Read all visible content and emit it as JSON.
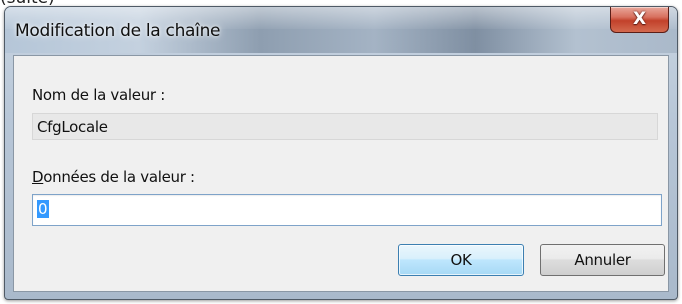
{
  "dialog": {
    "title": "Modification de la chaîne",
    "close_glyph": "X",
    "value_name_label": "Nom de la valeur :",
    "value_name": "CfgLocale",
    "value_data_label_first": "D",
    "value_data_label_rest": "onnées de la valeur :",
    "value_data": "0",
    "ok_label": "OK",
    "cancel_label": "Annuler"
  },
  "colors": {
    "selection": "#3399ff",
    "close_button": "#c2412b",
    "default_button_border": "#3c7fb1"
  }
}
